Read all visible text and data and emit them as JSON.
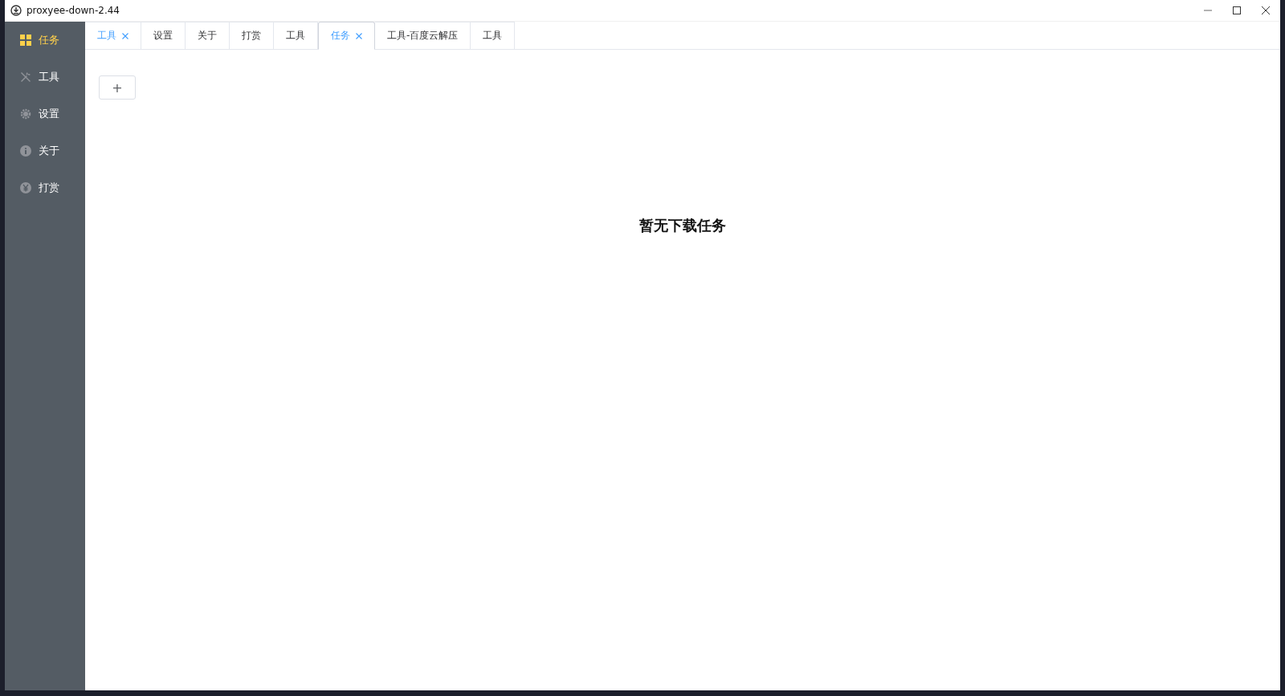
{
  "window": {
    "title": "proxyee-down-2.44"
  },
  "sidebar": {
    "items": [
      {
        "kind": "grid",
        "label": "任务",
        "selected": true
      },
      {
        "kind": "wrench",
        "label": "工具",
        "selected": false
      },
      {
        "kind": "gear",
        "label": "设置",
        "selected": false
      },
      {
        "kind": "info",
        "label": "关于",
        "selected": false
      },
      {
        "kind": "yen",
        "label": "打赏",
        "selected": false
      }
    ]
  },
  "tabs": [
    {
      "label": "工具",
      "selected": false,
      "hovered": true,
      "closable": true
    },
    {
      "label": "设置",
      "selected": false,
      "hovered": false,
      "closable": false
    },
    {
      "label": "关于",
      "selected": false,
      "hovered": false,
      "closable": false
    },
    {
      "label": "打赏",
      "selected": false,
      "hovered": false,
      "closable": false
    },
    {
      "label": "工具",
      "selected": false,
      "hovered": false,
      "closable": false
    },
    {
      "label": "任务",
      "selected": true,
      "hovered": false,
      "closable": true
    },
    {
      "label": "工具-百度云解压",
      "selected": false,
      "hovered": false,
      "closable": false
    },
    {
      "label": "工具",
      "selected": false,
      "hovered": false,
      "closable": false
    }
  ],
  "add_button": {
    "label": "+"
  },
  "empty_message": "暂无下载任务"
}
